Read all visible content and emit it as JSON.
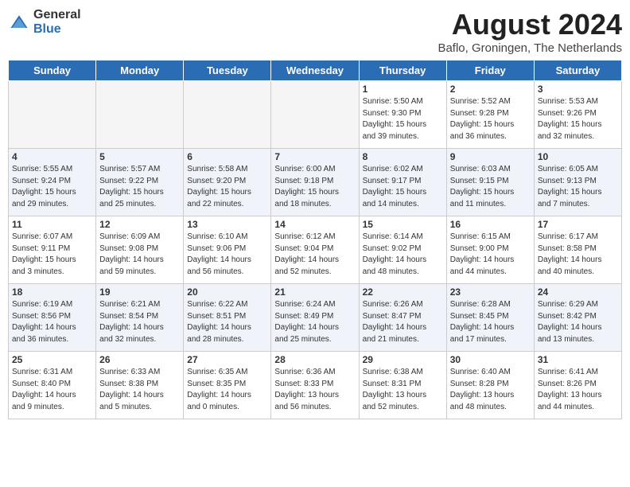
{
  "header": {
    "logo_general": "General",
    "logo_blue": "Blue",
    "month_year": "August 2024",
    "location": "Baflo, Groningen, The Netherlands"
  },
  "days_of_week": [
    "Sunday",
    "Monday",
    "Tuesday",
    "Wednesday",
    "Thursday",
    "Friday",
    "Saturday"
  ],
  "weeks": [
    [
      {
        "day": "",
        "info": ""
      },
      {
        "day": "",
        "info": ""
      },
      {
        "day": "",
        "info": ""
      },
      {
        "day": "",
        "info": ""
      },
      {
        "day": "1",
        "info": "Sunrise: 5:50 AM\nSunset: 9:30 PM\nDaylight: 15 hours\nand 39 minutes."
      },
      {
        "day": "2",
        "info": "Sunrise: 5:52 AM\nSunset: 9:28 PM\nDaylight: 15 hours\nand 36 minutes."
      },
      {
        "day": "3",
        "info": "Sunrise: 5:53 AM\nSunset: 9:26 PM\nDaylight: 15 hours\nand 32 minutes."
      }
    ],
    [
      {
        "day": "4",
        "info": "Sunrise: 5:55 AM\nSunset: 9:24 PM\nDaylight: 15 hours\nand 29 minutes."
      },
      {
        "day": "5",
        "info": "Sunrise: 5:57 AM\nSunset: 9:22 PM\nDaylight: 15 hours\nand 25 minutes."
      },
      {
        "day": "6",
        "info": "Sunrise: 5:58 AM\nSunset: 9:20 PM\nDaylight: 15 hours\nand 22 minutes."
      },
      {
        "day": "7",
        "info": "Sunrise: 6:00 AM\nSunset: 9:18 PM\nDaylight: 15 hours\nand 18 minutes."
      },
      {
        "day": "8",
        "info": "Sunrise: 6:02 AM\nSunset: 9:17 PM\nDaylight: 15 hours\nand 14 minutes."
      },
      {
        "day": "9",
        "info": "Sunrise: 6:03 AM\nSunset: 9:15 PM\nDaylight: 15 hours\nand 11 minutes."
      },
      {
        "day": "10",
        "info": "Sunrise: 6:05 AM\nSunset: 9:13 PM\nDaylight: 15 hours\nand 7 minutes."
      }
    ],
    [
      {
        "day": "11",
        "info": "Sunrise: 6:07 AM\nSunset: 9:11 PM\nDaylight: 15 hours\nand 3 minutes."
      },
      {
        "day": "12",
        "info": "Sunrise: 6:09 AM\nSunset: 9:08 PM\nDaylight: 14 hours\nand 59 minutes."
      },
      {
        "day": "13",
        "info": "Sunrise: 6:10 AM\nSunset: 9:06 PM\nDaylight: 14 hours\nand 56 minutes."
      },
      {
        "day": "14",
        "info": "Sunrise: 6:12 AM\nSunset: 9:04 PM\nDaylight: 14 hours\nand 52 minutes."
      },
      {
        "day": "15",
        "info": "Sunrise: 6:14 AM\nSunset: 9:02 PM\nDaylight: 14 hours\nand 48 minutes."
      },
      {
        "day": "16",
        "info": "Sunrise: 6:15 AM\nSunset: 9:00 PM\nDaylight: 14 hours\nand 44 minutes."
      },
      {
        "day": "17",
        "info": "Sunrise: 6:17 AM\nSunset: 8:58 PM\nDaylight: 14 hours\nand 40 minutes."
      }
    ],
    [
      {
        "day": "18",
        "info": "Sunrise: 6:19 AM\nSunset: 8:56 PM\nDaylight: 14 hours\nand 36 minutes."
      },
      {
        "day": "19",
        "info": "Sunrise: 6:21 AM\nSunset: 8:54 PM\nDaylight: 14 hours\nand 32 minutes."
      },
      {
        "day": "20",
        "info": "Sunrise: 6:22 AM\nSunset: 8:51 PM\nDaylight: 14 hours\nand 28 minutes."
      },
      {
        "day": "21",
        "info": "Sunrise: 6:24 AM\nSunset: 8:49 PM\nDaylight: 14 hours\nand 25 minutes."
      },
      {
        "day": "22",
        "info": "Sunrise: 6:26 AM\nSunset: 8:47 PM\nDaylight: 14 hours\nand 21 minutes."
      },
      {
        "day": "23",
        "info": "Sunrise: 6:28 AM\nSunset: 8:45 PM\nDaylight: 14 hours\nand 17 minutes."
      },
      {
        "day": "24",
        "info": "Sunrise: 6:29 AM\nSunset: 8:42 PM\nDaylight: 14 hours\nand 13 minutes."
      }
    ],
    [
      {
        "day": "25",
        "info": "Sunrise: 6:31 AM\nSunset: 8:40 PM\nDaylight: 14 hours\nand 9 minutes."
      },
      {
        "day": "26",
        "info": "Sunrise: 6:33 AM\nSunset: 8:38 PM\nDaylight: 14 hours\nand 5 minutes."
      },
      {
        "day": "27",
        "info": "Sunrise: 6:35 AM\nSunset: 8:35 PM\nDaylight: 14 hours\nand 0 minutes."
      },
      {
        "day": "28",
        "info": "Sunrise: 6:36 AM\nSunset: 8:33 PM\nDaylight: 13 hours\nand 56 minutes."
      },
      {
        "day": "29",
        "info": "Sunrise: 6:38 AM\nSunset: 8:31 PM\nDaylight: 13 hours\nand 52 minutes."
      },
      {
        "day": "30",
        "info": "Sunrise: 6:40 AM\nSunset: 8:28 PM\nDaylight: 13 hours\nand 48 minutes."
      },
      {
        "day": "31",
        "info": "Sunrise: 6:41 AM\nSunset: 8:26 PM\nDaylight: 13 hours\nand 44 minutes."
      }
    ]
  ]
}
